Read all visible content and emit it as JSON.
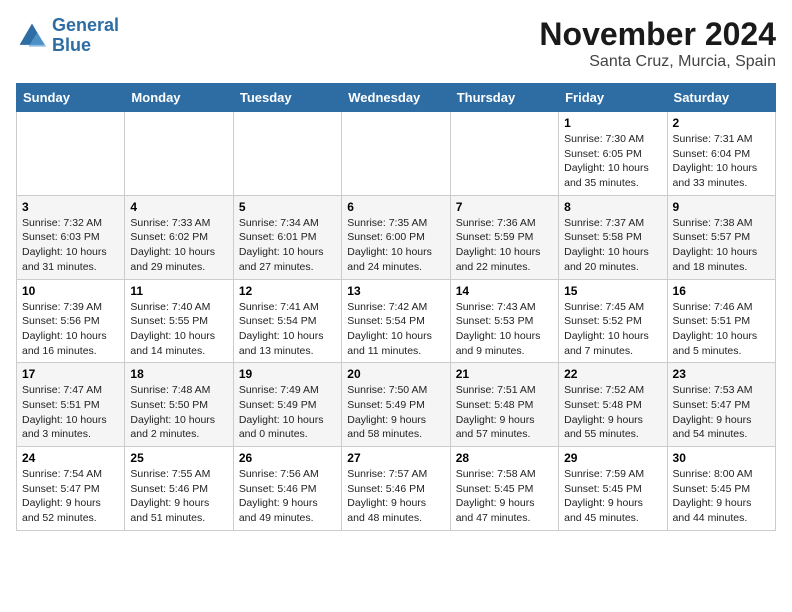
{
  "logo": {
    "line1": "General",
    "line2": "Blue"
  },
  "title": "November 2024",
  "location": "Santa Cruz, Murcia, Spain",
  "weekdays": [
    "Sunday",
    "Monday",
    "Tuesday",
    "Wednesday",
    "Thursday",
    "Friday",
    "Saturday"
  ],
  "weeks": [
    [
      {
        "day": "",
        "sunrise": "",
        "sunset": "",
        "daylight": ""
      },
      {
        "day": "",
        "sunrise": "",
        "sunset": "",
        "daylight": ""
      },
      {
        "day": "",
        "sunrise": "",
        "sunset": "",
        "daylight": ""
      },
      {
        "day": "",
        "sunrise": "",
        "sunset": "",
        "daylight": ""
      },
      {
        "day": "",
        "sunrise": "",
        "sunset": "",
        "daylight": ""
      },
      {
        "day": "1",
        "sunrise": "Sunrise: 7:30 AM",
        "sunset": "Sunset: 6:05 PM",
        "daylight": "Daylight: 10 hours and 35 minutes."
      },
      {
        "day": "2",
        "sunrise": "Sunrise: 7:31 AM",
        "sunset": "Sunset: 6:04 PM",
        "daylight": "Daylight: 10 hours and 33 minutes."
      }
    ],
    [
      {
        "day": "3",
        "sunrise": "Sunrise: 7:32 AM",
        "sunset": "Sunset: 6:03 PM",
        "daylight": "Daylight: 10 hours and 31 minutes."
      },
      {
        "day": "4",
        "sunrise": "Sunrise: 7:33 AM",
        "sunset": "Sunset: 6:02 PM",
        "daylight": "Daylight: 10 hours and 29 minutes."
      },
      {
        "day": "5",
        "sunrise": "Sunrise: 7:34 AM",
        "sunset": "Sunset: 6:01 PM",
        "daylight": "Daylight: 10 hours and 27 minutes."
      },
      {
        "day": "6",
        "sunrise": "Sunrise: 7:35 AM",
        "sunset": "Sunset: 6:00 PM",
        "daylight": "Daylight: 10 hours and 24 minutes."
      },
      {
        "day": "7",
        "sunrise": "Sunrise: 7:36 AM",
        "sunset": "Sunset: 5:59 PM",
        "daylight": "Daylight: 10 hours and 22 minutes."
      },
      {
        "day": "8",
        "sunrise": "Sunrise: 7:37 AM",
        "sunset": "Sunset: 5:58 PM",
        "daylight": "Daylight: 10 hours and 20 minutes."
      },
      {
        "day": "9",
        "sunrise": "Sunrise: 7:38 AM",
        "sunset": "Sunset: 5:57 PM",
        "daylight": "Daylight: 10 hours and 18 minutes."
      }
    ],
    [
      {
        "day": "10",
        "sunrise": "Sunrise: 7:39 AM",
        "sunset": "Sunset: 5:56 PM",
        "daylight": "Daylight: 10 hours and 16 minutes."
      },
      {
        "day": "11",
        "sunrise": "Sunrise: 7:40 AM",
        "sunset": "Sunset: 5:55 PM",
        "daylight": "Daylight: 10 hours and 14 minutes."
      },
      {
        "day": "12",
        "sunrise": "Sunrise: 7:41 AM",
        "sunset": "Sunset: 5:54 PM",
        "daylight": "Daylight: 10 hours and 13 minutes."
      },
      {
        "day": "13",
        "sunrise": "Sunrise: 7:42 AM",
        "sunset": "Sunset: 5:54 PM",
        "daylight": "Daylight: 10 hours and 11 minutes."
      },
      {
        "day": "14",
        "sunrise": "Sunrise: 7:43 AM",
        "sunset": "Sunset: 5:53 PM",
        "daylight": "Daylight: 10 hours and 9 minutes."
      },
      {
        "day": "15",
        "sunrise": "Sunrise: 7:45 AM",
        "sunset": "Sunset: 5:52 PM",
        "daylight": "Daylight: 10 hours and 7 minutes."
      },
      {
        "day": "16",
        "sunrise": "Sunrise: 7:46 AM",
        "sunset": "Sunset: 5:51 PM",
        "daylight": "Daylight: 10 hours and 5 minutes."
      }
    ],
    [
      {
        "day": "17",
        "sunrise": "Sunrise: 7:47 AM",
        "sunset": "Sunset: 5:51 PM",
        "daylight": "Daylight: 10 hours and 3 minutes."
      },
      {
        "day": "18",
        "sunrise": "Sunrise: 7:48 AM",
        "sunset": "Sunset: 5:50 PM",
        "daylight": "Daylight: 10 hours and 2 minutes."
      },
      {
        "day": "19",
        "sunrise": "Sunrise: 7:49 AM",
        "sunset": "Sunset: 5:49 PM",
        "daylight": "Daylight: 10 hours and 0 minutes."
      },
      {
        "day": "20",
        "sunrise": "Sunrise: 7:50 AM",
        "sunset": "Sunset: 5:49 PM",
        "daylight": "Daylight: 9 hours and 58 minutes."
      },
      {
        "day": "21",
        "sunrise": "Sunrise: 7:51 AM",
        "sunset": "Sunset: 5:48 PM",
        "daylight": "Daylight: 9 hours and 57 minutes."
      },
      {
        "day": "22",
        "sunrise": "Sunrise: 7:52 AM",
        "sunset": "Sunset: 5:48 PM",
        "daylight": "Daylight: 9 hours and 55 minutes."
      },
      {
        "day": "23",
        "sunrise": "Sunrise: 7:53 AM",
        "sunset": "Sunset: 5:47 PM",
        "daylight": "Daylight: 9 hours and 54 minutes."
      }
    ],
    [
      {
        "day": "24",
        "sunrise": "Sunrise: 7:54 AM",
        "sunset": "Sunset: 5:47 PM",
        "daylight": "Daylight: 9 hours and 52 minutes."
      },
      {
        "day": "25",
        "sunrise": "Sunrise: 7:55 AM",
        "sunset": "Sunset: 5:46 PM",
        "daylight": "Daylight: 9 hours and 51 minutes."
      },
      {
        "day": "26",
        "sunrise": "Sunrise: 7:56 AM",
        "sunset": "Sunset: 5:46 PM",
        "daylight": "Daylight: 9 hours and 49 minutes."
      },
      {
        "day": "27",
        "sunrise": "Sunrise: 7:57 AM",
        "sunset": "Sunset: 5:46 PM",
        "daylight": "Daylight: 9 hours and 48 minutes."
      },
      {
        "day": "28",
        "sunrise": "Sunrise: 7:58 AM",
        "sunset": "Sunset: 5:45 PM",
        "daylight": "Daylight: 9 hours and 47 minutes."
      },
      {
        "day": "29",
        "sunrise": "Sunrise: 7:59 AM",
        "sunset": "Sunset: 5:45 PM",
        "daylight": "Daylight: 9 hours and 45 minutes."
      },
      {
        "day": "30",
        "sunrise": "Sunrise: 8:00 AM",
        "sunset": "Sunset: 5:45 PM",
        "daylight": "Daylight: 9 hours and 44 minutes."
      }
    ]
  ]
}
